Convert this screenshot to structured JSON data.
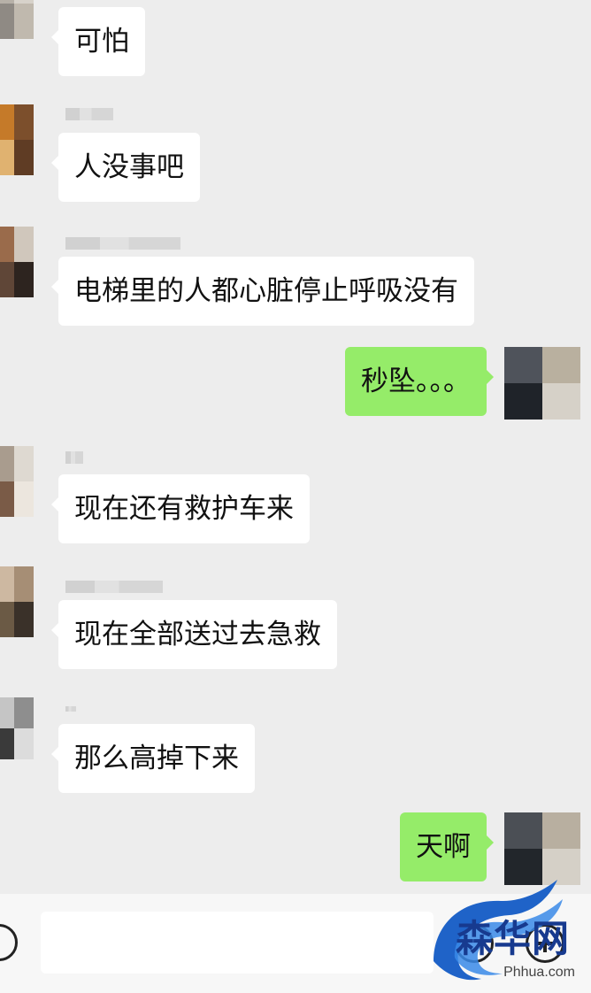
{
  "chat": {
    "messages": [
      {
        "side": "left",
        "text": "可怕"
      },
      {
        "side": "left",
        "text": "人没事吧"
      },
      {
        "side": "left",
        "text": "电梯里的人都心脏停止呼吸没有"
      },
      {
        "side": "right",
        "text": "秒坠。。。"
      },
      {
        "side": "left",
        "text": "现在还有救护车来"
      },
      {
        "side": "left",
        "text": "现在全部送过去急救"
      },
      {
        "side": "left",
        "text": "那么高掉下来"
      },
      {
        "side": "right",
        "text": "天啊"
      }
    ]
  },
  "colors": {
    "background": "#ededed",
    "sent_bubble": "#95ec69",
    "received_bubble": "#ffffff",
    "brand": "#173a8f"
  },
  "icons": {
    "voice": "voice-icon",
    "emoji": "emoji-icon",
    "plus": "plus-icon",
    "logo": "dragon-logo-icon"
  },
  "watermark": {
    "brand_text": "森华网",
    "site": "Phhua.com"
  }
}
